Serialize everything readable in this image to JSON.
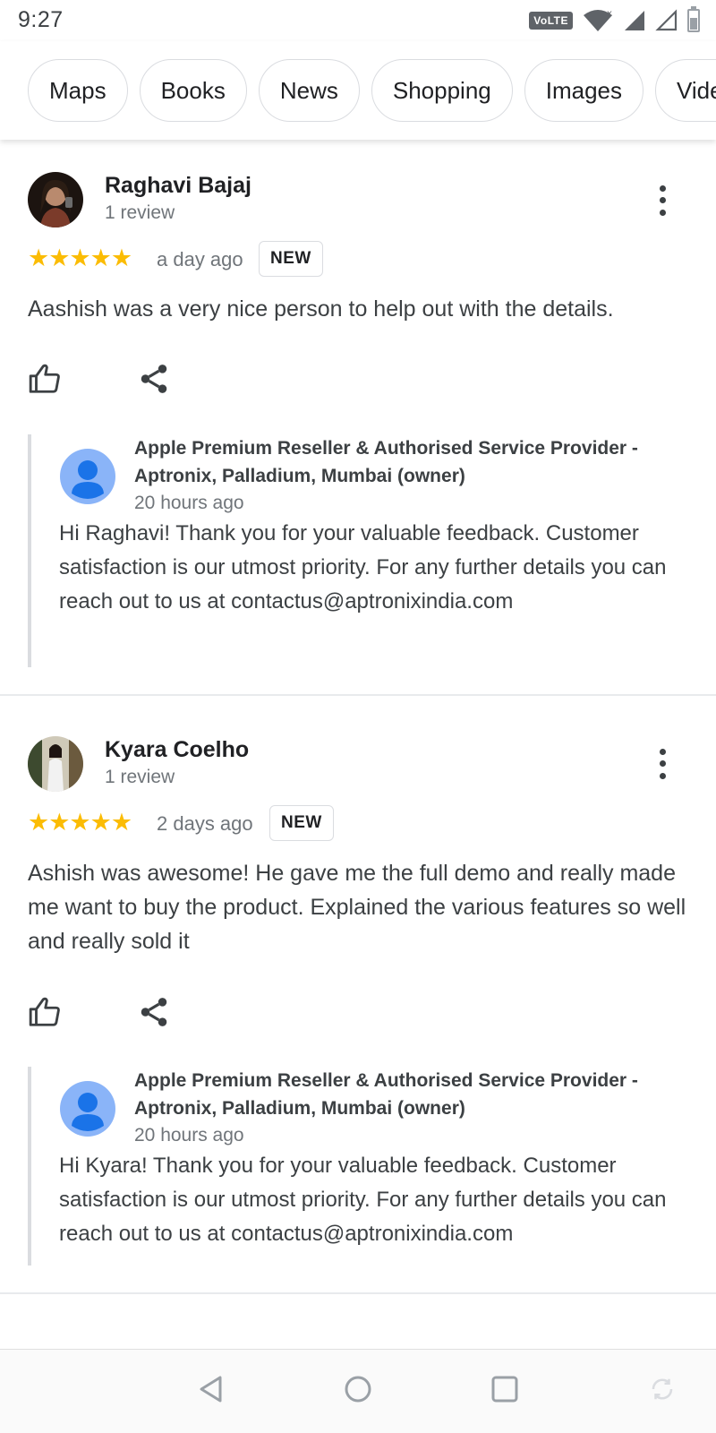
{
  "status_bar": {
    "time": "9:27",
    "network_badge": "VoLTE",
    "icons": [
      "wifi-icon",
      "signal-icon",
      "signal-empty-icon",
      "battery-icon"
    ]
  },
  "chips": [
    "Maps",
    "Books",
    "News",
    "Shopping",
    "Images",
    "Videos"
  ],
  "reviews": [
    {
      "name": "Raghavi Bajaj",
      "review_count": "1 review",
      "rating": 5,
      "stars": "★★★★★",
      "time": "a day ago",
      "badge": "NEW",
      "text": "Aashish was a very nice person to help out with the details.",
      "reply": {
        "owner_name": "Apple Premium Reseller & Authorised Service Provider - Aptronix, Palladium, Mumbai (owner)",
        "time": "20 hours ago",
        "text": "Hi Raghavi! Thank you for your valuable feedback. Customer satisfaction is our utmost priority. For any further details you can reach out to us at contactus@aptronixindia.com"
      }
    },
    {
      "name": "Kyara Coelho",
      "review_count": "1 review",
      "rating": 5,
      "stars": "★★★★★",
      "time": "2 days ago",
      "badge": "NEW",
      "text": "Ashish was awesome! He gave me the full demo and really made me want to buy the product. Explained the various features so well and really sold it",
      "reply": {
        "owner_name": "Apple Premium Reseller & Authorised Service Provider - Aptronix, Palladium, Mumbai (owner)",
        "time": "20 hours ago",
        "text": "Hi Kyara! Thank you for your valuable feedback. Customer satisfaction is our utmost priority. For any further details you can reach out to us at contactus@aptronixindia.com"
      }
    }
  ],
  "colors": {
    "star": "#fbbc04",
    "owner_avatar": "#8ab4f8",
    "owner_avatar_figure": "#1a73e8",
    "text_secondary": "#70757a",
    "chip_border": "#dadce0"
  },
  "nav_bar": {
    "icons": [
      "back-icon",
      "home-icon",
      "recents-icon",
      "rotate-icon"
    ]
  }
}
